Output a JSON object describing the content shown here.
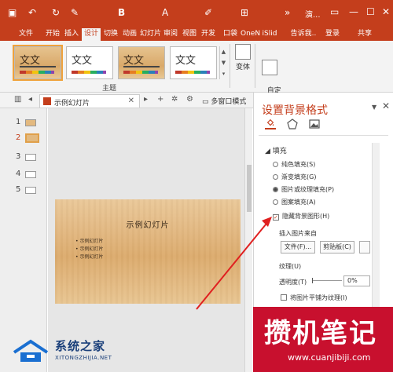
{
  "titlebar": {
    "title": "演...",
    "bg_color": "#c43e1c",
    "quick_access_icons": [
      "save-icon",
      "undo-icon",
      "redo-icon",
      "eyedropper-icon",
      "bold-icon",
      "text-box-icon",
      "pen-icon",
      "table-icon",
      "collapse-icon"
    ]
  },
  "ribbon_tabs": [
    "文件",
    "开始",
    "插入",
    "设计",
    "切换",
    "动画",
    "幻灯片",
    "审阅",
    "视图",
    "开发",
    "口袋",
    "OneN",
    "iSlid",
    "告诉我..",
    "登录",
    "共享"
  ],
  "active_tab": "设计",
  "ribbon": {
    "themes": [
      {
        "text": "文文",
        "style": "wood",
        "selected": true
      },
      {
        "text": "文文",
        "style": "plain",
        "selected": false
      },
      {
        "text": "文文",
        "style": "wood",
        "selected": false
      },
      {
        "text": "文文",
        "style": "plain",
        "selected": false
      }
    ],
    "group_label": "主题",
    "variant_label": "变体",
    "custom_label": "自定\n义"
  },
  "subbar": {
    "doc_tab_label": "示例幻灯片",
    "multi_window_label": "多窗口模式"
  },
  "thumbnails": [
    {
      "num": "1",
      "active": false
    },
    {
      "num": "2",
      "active": true
    },
    {
      "num": "3",
      "active": false
    },
    {
      "num": "4",
      "active": false
    },
    {
      "num": "5",
      "active": false
    }
  ],
  "slide": {
    "title": "示例幻灯片",
    "bullets": [
      "示例幻灯片",
      "示例幻灯片",
      "示例幻灯片"
    ]
  },
  "format_pane": {
    "title": "设置背景格式",
    "section": "填充",
    "fill_options": [
      {
        "label": "纯色填充(S)",
        "selected": false
      },
      {
        "label": "渐变填充(G)",
        "selected": false
      },
      {
        "label": "图片或纹理填充(P)",
        "selected": true
      },
      {
        "label": "图案填充(A)",
        "selected": false
      }
    ],
    "hide_bg_graphics": {
      "label": "隐藏背景图形(H)",
      "checked": true
    },
    "insert_from_label": "插入图片来自",
    "file_button": "文件(F)...",
    "clipboard_button": "剪贴板(C)",
    "texture_label": "纹理(U)",
    "transparency_label": "透明度(T)",
    "transparency_value": "0%",
    "tile_label": "将图片平铺为纹理(I)",
    "accent_color": "#c43e1c"
  },
  "watermarks": {
    "left_name": "系统之家",
    "left_url": "XITONGZHIJIA.NET",
    "right_name": "攒机笔记",
    "right_url": "www.cuanjibiji.com"
  }
}
